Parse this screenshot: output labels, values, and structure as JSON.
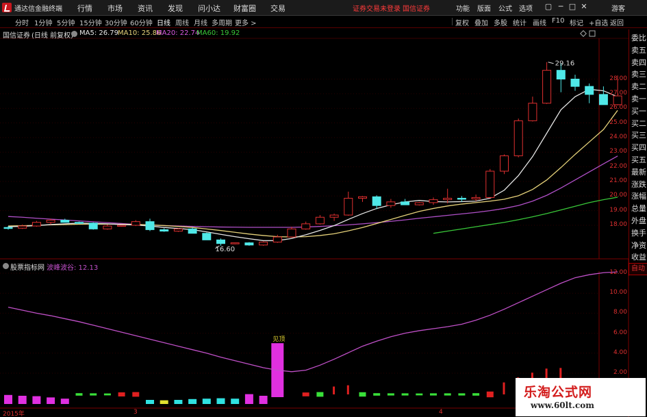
{
  "window": {
    "app_name": "通达信金融终端",
    "menu": [
      "行情",
      "市场",
      "资讯",
      "发现",
      "问小达",
      "财富圈",
      "交易"
    ],
    "login_status": "证券交易未登录",
    "broker": "国信证券",
    "right_tools": [
      "功能",
      "版面",
      "公式",
      "选项"
    ],
    "guest_label": "游客",
    "window_buttons": [
      "▢",
      "─",
      "□",
      "✕"
    ]
  },
  "periods": [
    "分时",
    "1分钟",
    "5分钟",
    "15分钟",
    "30分钟",
    "60分钟",
    "日线",
    "周线",
    "月线",
    "多周期",
    "更多 >"
  ],
  "active_period": "日线",
  "toolbar_right": [
    "复权",
    "叠加",
    "多股",
    "统计",
    "画线",
    "F10",
    "标记",
    "+自选",
    "返回"
  ],
  "stock": {
    "name": "国信证券",
    "mode": "(日线 前复权)"
  },
  "ma_legend": [
    {
      "label": "MA5: 26.79",
      "color": "#e6e6e6"
    },
    {
      "label": "MA10: 25.86",
      "color": "#e6d27a"
    },
    {
      "label": "MA20: 22.74",
      "color": "#d85ae0"
    },
    {
      "label": "MA60: 19.92",
      "color": "#39c839"
    }
  ],
  "price_axis": [
    "28.00",
    "27.00",
    "26.00",
    "25.00",
    "24.00",
    "23.00",
    "22.00",
    "21.00",
    "20.00",
    "19.00",
    "18.00"
  ],
  "annotations": {
    "high": "29.16",
    "low": "16.60"
  },
  "right_tabs": [
    "委比",
    "卖五",
    "卖四",
    "卖三",
    "卖二",
    "卖一",
    "买一",
    "买二",
    "买三",
    "买四",
    "买五",
    "最新",
    "涨跌",
    "涨幅",
    "总量",
    "外盘",
    "换手",
    "净资",
    "收益"
  ],
  "indicator": {
    "name": "股票指标网",
    "legend": "波峰波谷: 12.13",
    "axis": [
      "12.00",
      "10.00",
      "8.00",
      "6.00",
      "4.00",
      "2.00"
    ],
    "peak_label": "见顶",
    "auto_label": "自动"
  },
  "date_labels": [
    "2015年",
    "3",
    "4"
  ],
  "watermark": {
    "brand": "乐淘公式网",
    "url": "www.60lt.com"
  },
  "colors": {
    "up": "#e03030",
    "down": "#4fe8e8",
    "ma5": "#e6e6e6",
    "ma10": "#e6d27a",
    "ma20": "#b050c8",
    "ma60": "#39c839",
    "indicator_line": "#c050c8"
  },
  "chart_data": {
    "type": "candlestick",
    "period": "daily",
    "ohlc": [
      [
        17.85,
        17.95,
        17.7,
        17.8
      ],
      [
        17.8,
        18.05,
        17.75,
        17.95
      ],
      [
        17.95,
        18.3,
        17.9,
        18.2
      ],
      [
        18.2,
        18.45,
        18.05,
        18.35
      ],
      [
        18.35,
        18.45,
        18.25,
        18.2
      ],
      [
        18.2,
        18.25,
        18.1,
        18.15
      ],
      [
        18.15,
        18.2,
        17.7,
        17.75
      ],
      [
        17.75,
        18.05,
        17.7,
        17.95
      ],
      [
        17.95,
        18.0,
        17.9,
        18.0
      ],
      [
        18.0,
        18.35,
        17.95,
        18.25
      ],
      [
        18.25,
        18.45,
        17.6,
        17.7
      ],
      [
        17.7,
        17.8,
        17.55,
        17.6
      ],
      [
        17.6,
        17.8,
        17.55,
        17.75
      ],
      [
        17.75,
        17.85,
        17.55,
        17.45
      ],
      [
        17.45,
        17.5,
        17.05,
        17.0
      ],
      [
        17.0,
        17.1,
        16.6,
        16.75
      ],
      [
        16.75,
        16.8,
        16.7,
        16.8
      ],
      [
        16.8,
        16.85,
        16.6,
        16.65
      ],
      [
        16.65,
        16.9,
        16.6,
        16.85
      ],
      [
        16.85,
        17.35,
        16.8,
        17.2
      ],
      [
        17.2,
        17.9,
        17.15,
        17.75
      ],
      [
        17.75,
        18.25,
        17.7,
        18.1
      ],
      [
        18.1,
        18.7,
        18.05,
        18.55
      ],
      [
        18.55,
        18.8,
        18.3,
        18.7
      ],
      [
        18.7,
        20.3,
        18.65,
        19.85
      ],
      [
        19.85,
        20.0,
        19.6,
        19.95
      ],
      [
        19.95,
        20.05,
        19.1,
        19.35
      ],
      [
        19.35,
        19.8,
        19.2,
        19.6
      ],
      [
        19.6,
        19.8,
        19.45,
        19.4
      ],
      [
        19.4,
        19.6,
        19.35,
        19.55
      ],
      [
        19.55,
        19.9,
        19.4,
        19.75
      ],
      [
        19.75,
        20.5,
        19.5,
        19.85
      ],
      [
        19.85,
        20.0,
        19.6,
        19.8
      ],
      [
        19.8,
        20.1,
        19.65,
        19.9
      ],
      [
        19.9,
        21.85,
        19.85,
        21.7
      ],
      [
        21.7,
        22.85,
        21.5,
        22.75
      ],
      [
        22.75,
        25.3,
        22.65,
        25.15
      ],
      [
        25.15,
        26.8,
        25.1,
        26.35
      ],
      [
        26.35,
        29.16,
        26.3,
        28.6
      ],
      [
        28.6,
        29.1,
        27.1,
        28.0
      ],
      [
        28.0,
        28.3,
        27.2,
        27.5
      ],
      [
        27.5,
        27.7,
        26.35,
        26.95
      ],
      [
        26.95,
        27.5,
        26.9,
        26.25
      ],
      [
        26.25,
        28.25,
        26.2,
        26.85
      ]
    ],
    "ma5": [
      17.9,
      17.93,
      17.98,
      18.05,
      18.1,
      18.15,
      18.13,
      18.1,
      18.05,
      18.02,
      17.95,
      17.85,
      17.78,
      17.7,
      17.55,
      17.38,
      17.22,
      17.08,
      16.95,
      16.95,
      17.1,
      17.35,
      17.65,
      17.98,
      18.4,
      18.8,
      19.15,
      19.4,
      19.6,
      19.7,
      19.62,
      19.6,
      19.62,
      19.65,
      19.85,
      20.4,
      21.4,
      22.7,
      24.3,
      25.9,
      26.8,
      27.3,
      27.2,
      26.79
    ],
    "ma10": [
      17.95,
      17.97,
      18.0,
      18.03,
      18.05,
      18.07,
      18.08,
      18.08,
      18.07,
      18.06,
      18.03,
      17.98,
      17.92,
      17.85,
      17.75,
      17.64,
      17.52,
      17.4,
      17.3,
      17.22,
      17.2,
      17.22,
      17.3,
      17.42,
      17.62,
      17.85,
      18.12,
      18.4,
      18.68,
      18.95,
      19.15,
      19.32,
      19.45,
      19.55,
      19.65,
      19.78,
      20.02,
      20.45,
      21.1,
      21.95,
      22.85,
      23.7,
      24.55,
      25.86
    ],
    "ma20": [
      18.6,
      18.55,
      18.48,
      18.42,
      18.36,
      18.3,
      18.24,
      18.18,
      18.12,
      18.06,
      18.02,
      17.98,
      17.95,
      17.92,
      17.9,
      17.88,
      17.87,
      17.86,
      17.86,
      17.86,
      17.86,
      17.88,
      17.92,
      17.97,
      18.03,
      18.1,
      18.18,
      18.27,
      18.37,
      18.48,
      18.58,
      18.68,
      18.78,
      18.88,
      19.0,
      19.15,
      19.35,
      19.65,
      20.05,
      20.55,
      21.1,
      21.65,
      22.2,
      22.74
    ],
    "ma60": [
      null,
      null,
      null,
      null,
      null,
      null,
      null,
      null,
      null,
      null,
      null,
      null,
      null,
      null,
      null,
      null,
      null,
      null,
      null,
      null,
      null,
      null,
      null,
      null,
      null,
      null,
      null,
      null,
      null,
      null,
      17.45,
      17.6,
      17.75,
      17.9,
      18.05,
      18.2,
      18.38,
      18.58,
      18.8,
      19.05,
      19.3,
      19.55,
      19.75,
      19.92
    ],
    "indicator_line": [
      8.6,
      8.3,
      8.0,
      7.75,
      7.45,
      7.15,
      6.8,
      6.45,
      6.1,
      5.75,
      5.4,
      5.05,
      4.7,
      4.35,
      4.0,
      3.6,
      3.25,
      2.9,
      2.55,
      2.3,
      2.15,
      2.3,
      2.8,
      3.4,
      4.05,
      4.7,
      5.2,
      5.65,
      6.0,
      6.25,
      6.45,
      6.65,
      6.9,
      7.3,
      7.8,
      8.4,
      9.05,
      9.7,
      10.35,
      11.0,
      11.55,
      11.85,
      12.05,
      12.13
    ],
    "indicator_bars": [
      {
        "i": 0,
        "v": 0.2,
        "c": "m",
        "up": 1.1
      },
      {
        "i": 1,
        "v": 0.2,
        "c": "m",
        "up": 1.0
      },
      {
        "i": 2,
        "v": 0.3,
        "c": "m",
        "up": 0.95
      },
      {
        "i": 3,
        "v": 0.35,
        "c": "m",
        "up": 0.8
      },
      {
        "i": 4,
        "v": 0.5,
        "c": "m",
        "up": 0.65
      },
      {
        "i": 5,
        "v": 0.55,
        "c": "g",
        "up": 0.45
      },
      {
        "i": 6,
        "v": 0.6,
        "c": "g",
        "up": 0.4
      },
      {
        "i": 7,
        "v": 0.6,
        "c": "g",
        "up": 0.35
      },
      {
        "i": 8,
        "v": 0.55,
        "c": "r",
        "up": 0.75
      },
      {
        "i": 9,
        "v": 0.5,
        "c": "r",
        "up": 0.85
      },
      {
        "i": 10,
        "v": 0.6,
        "c": "c",
        "up": 0.5
      },
      {
        "i": 11,
        "v": 0.55,
        "c": "y",
        "up": 0.45
      },
      {
        "i": 12,
        "v": 0.4,
        "c": "c",
        "up": 0.5
      },
      {
        "i": 13,
        "v": 0.2,
        "c": "c",
        "up": 0.6
      },
      {
        "i": 14,
        "v": 0.1,
        "c": "c",
        "up": 0.65
      },
      {
        "i": 15,
        "v": 0.2,
        "c": "c",
        "up": 0.7
      },
      {
        "i": 16,
        "v": 0.2,
        "c": "c",
        "up": 0.65
      },
      {
        "i": 17,
        "v": 0.25,
        "c": "m",
        "up": 1.2
      },
      {
        "i": 18,
        "v": 0.4,
        "c": "m",
        "up": 1.0
      },
      {
        "i": 19,
        "v": 0.0,
        "c": "M",
        "up": 5.0
      },
      {
        "i": 21,
        "v": 0.6,
        "c": "r",
        "up": 0.7
      },
      {
        "i": 22,
        "v": 0.55,
        "c": "g",
        "up": 0.85
      },
      {
        "i": 23,
        "v": 0.5,
        "c": "r",
        "up": 1.25
      },
      {
        "i": 24,
        "v": 0.6,
        "c": "r",
        "up": 1.45
      },
      {
        "i": 25,
        "v": 0.55,
        "c": "g",
        "up": 0.8
      },
      {
        "i": 26,
        "v": 0.6,
        "c": "g",
        "up": 0.45
      },
      {
        "i": 27,
        "v": 0.55,
        "c": "g",
        "up": 0.4
      },
      {
        "i": 28,
        "v": 0.6,
        "c": "g",
        "up": 0.4
      },
      {
        "i": 29,
        "v": 0.6,
        "c": "g",
        "up": 0.35
      },
      {
        "i": 30,
        "v": 0.6,
        "c": "g",
        "up": 0.4
      },
      {
        "i": 31,
        "v": 0.6,
        "c": "g",
        "up": 0.4
      },
      {
        "i": 32,
        "v": 0.6,
        "c": "g",
        "up": 0.4
      },
      {
        "i": 33,
        "v": 0.55,
        "c": "g",
        "up": 0.45
      },
      {
        "i": 34,
        "v": 0.55,
        "c": "r",
        "up": 1.05
      },
      {
        "i": 35,
        "v": 0.5,
        "c": "r",
        "up": 1.9
      },
      {
        "i": 36,
        "v": 0.5,
        "c": "r",
        "up": 2.7
      },
      {
        "i": 37,
        "v": 0.5,
        "c": "r",
        "up": 3.45
      },
      {
        "i": 38,
        "v": 0.4,
        "c": "r",
        "up": 4.1
      },
      {
        "i": 39,
        "v": 0.4,
        "c": "r",
        "up": 4.2
      }
    ]
  }
}
